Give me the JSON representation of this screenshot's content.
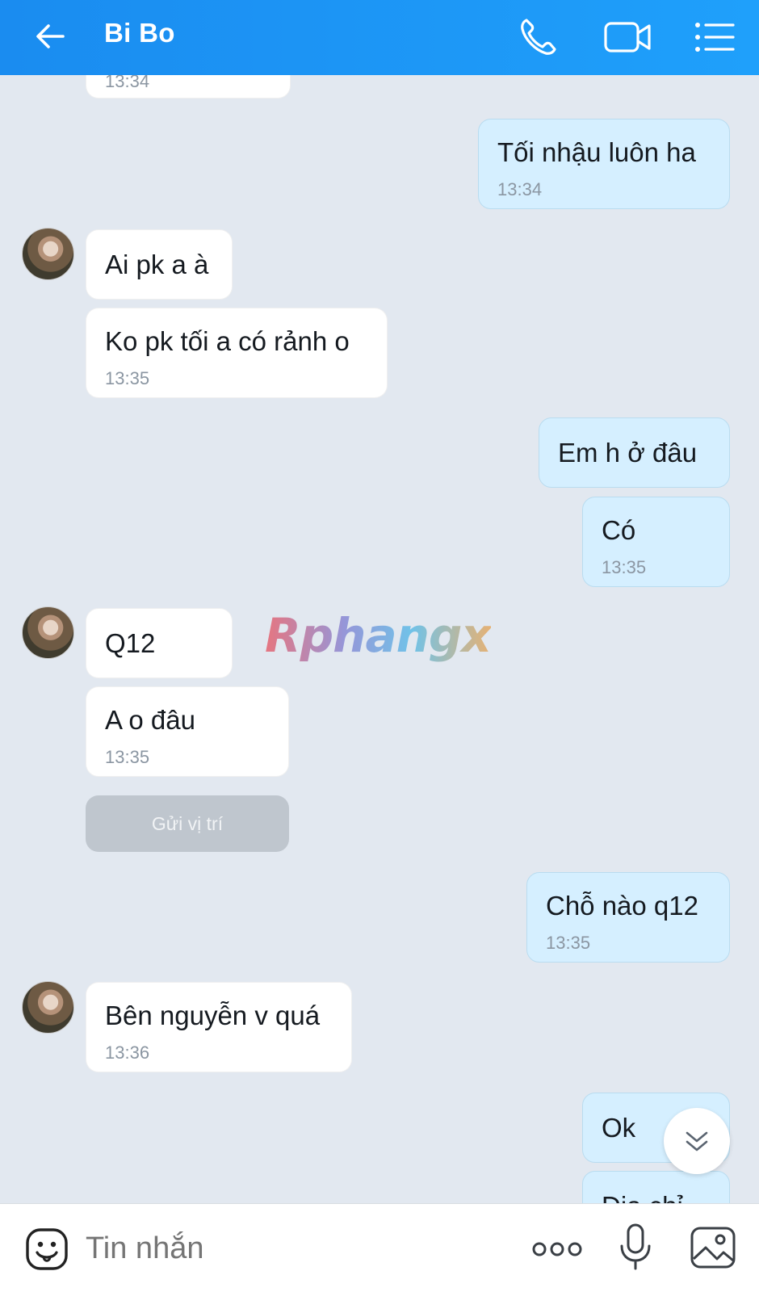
{
  "header": {
    "title": "Bi Bo",
    "icons": [
      "back-arrow-icon",
      "phone-icon",
      "video-call-icon",
      "menu-list-icon"
    ]
  },
  "messages": [
    {
      "id": "m0",
      "side": "in",
      "text": "",
      "time": "13:34"
    },
    {
      "id": "m1",
      "side": "out",
      "text": "Tối nhậu luôn ha",
      "time": "13:34"
    },
    {
      "id": "m2",
      "side": "in",
      "text": "Ai pk a à",
      "time": ""
    },
    {
      "id": "m3",
      "side": "in",
      "text": "Ko pk tối a có rảnh o",
      "time": "13:35"
    },
    {
      "id": "m4",
      "side": "out",
      "text": "Em h ở đâu",
      "time": ""
    },
    {
      "id": "m5",
      "side": "out",
      "text": "Có",
      "time": "13:35"
    },
    {
      "id": "m6",
      "side": "in",
      "text": "Q12",
      "time": ""
    },
    {
      "id": "m7",
      "side": "in",
      "text": "A o đâu",
      "time": "13:35"
    },
    {
      "id": "m8",
      "side": "out",
      "text": "Chỗ nào q12",
      "time": "13:35"
    },
    {
      "id": "m9",
      "side": "in",
      "text": "Bên nguyễn v quá",
      "time": "13:36"
    },
    {
      "id": "m10",
      "side": "out",
      "text": "Ok",
      "time": ""
    },
    {
      "id": "m11",
      "side": "out",
      "text": "Địa chỉ",
      "time": ""
    }
  ],
  "location_button": "Gửi vị trí",
  "watermark": "Rphangx",
  "composer": {
    "placeholder": "Tin nhắn",
    "icons": [
      "emoji-sticker-icon",
      "more-options-icon",
      "microphone-icon",
      "image-gallery-icon"
    ]
  },
  "colors": {
    "header_gradient_start": "#1a8cf0",
    "header_gradient_end": "#1fa0fb",
    "chat_background": "#e2e8f0",
    "incoming_bubble": "#ffffff",
    "outgoing_bubble": "#d5efff"
  }
}
